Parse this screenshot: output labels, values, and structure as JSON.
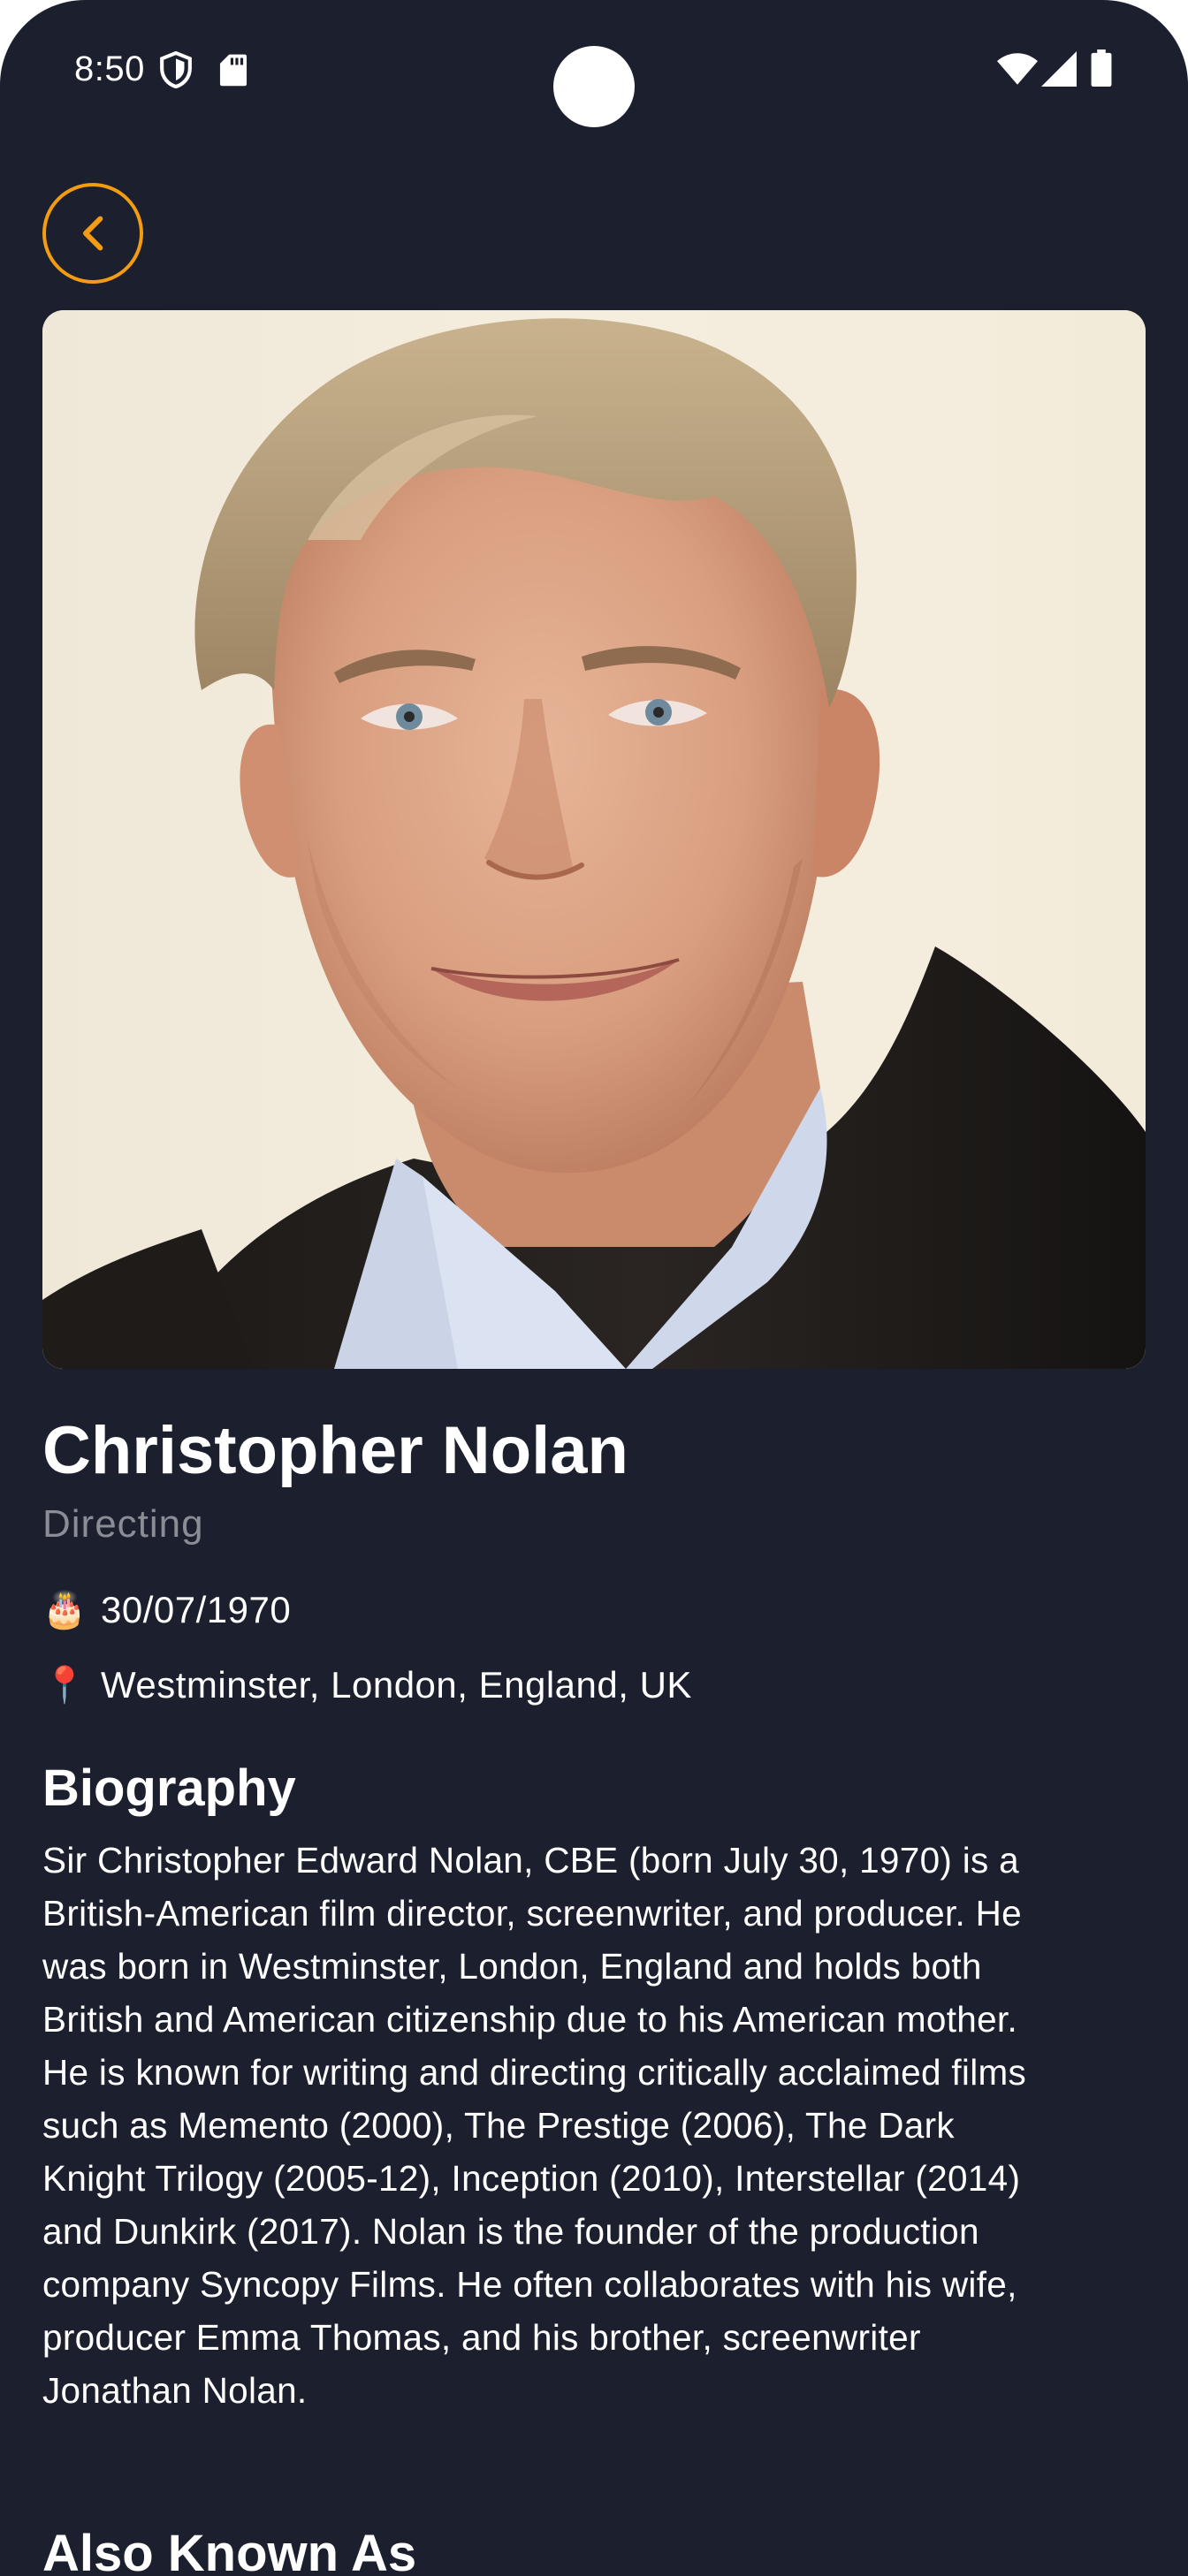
{
  "status_bar": {
    "time": "8:50",
    "icons": [
      "shield-icon",
      "sd-card-icon",
      "wifi-icon",
      "signal-icon",
      "battery-icon"
    ]
  },
  "back_button": {
    "icon": "chevron-left-icon",
    "accent_color": "#f39c12"
  },
  "person": {
    "name": "Christopher Nolan",
    "department": "Directing",
    "birthday_icon": "🎂",
    "birthday": "30/07/1970",
    "place_icon": "📍",
    "place_of_birth": "Westminster, London, England, UK"
  },
  "biography": {
    "title": "Biography",
    "lines": [
      "Sir Christopher Edward Nolan, CBE (born July 30, 1970) is a",
      "British-American film director, screenwriter, and producer. He",
      "was born in Westminster, London, England and holds both",
      "British and American citizenship due to his American mother.",
      "He is known for writing and directing critically acclaimed films",
      "such as Memento (2000), The Prestige (2006), The Dark",
      "Knight Trilogy (2005-12), Inception (2010), Interstellar (2014)",
      "and Dunkirk (2017). Nolan is the founder of the production",
      "company Syncopy Films. He often collaborates with his wife,",
      "producer Emma Thomas, and his brother, screenwriter",
      "Jonathan Nolan."
    ]
  },
  "also_known_as": {
    "title": "Also Known As"
  },
  "colors": {
    "background": "#1b1f2e",
    "accent": "#f39c12",
    "muted_text": "#8a8d96"
  }
}
